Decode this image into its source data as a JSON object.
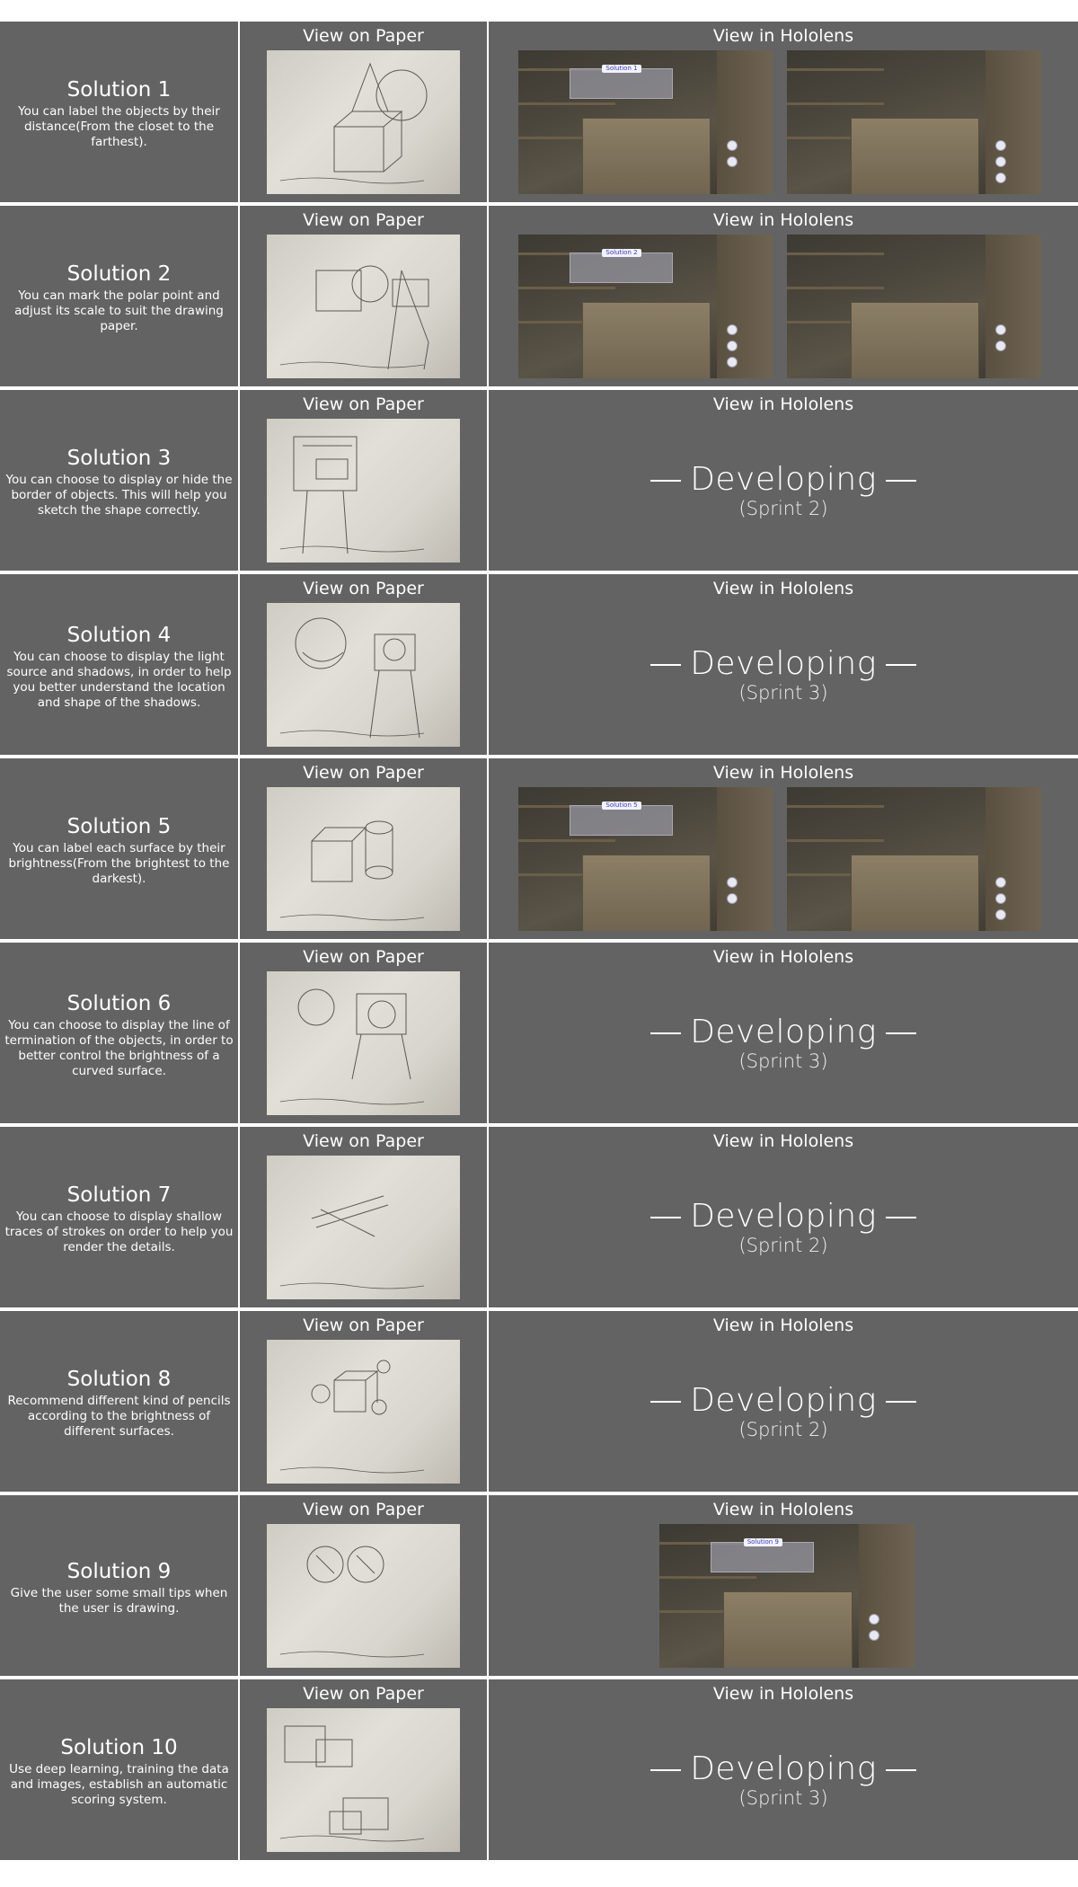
{
  "headers": {
    "paper": "View on Paper",
    "holo": "View in Hololens"
  },
  "developing": {
    "label": "Developing"
  },
  "solutions": [
    {
      "title": "Solution 1",
      "text": "You can label the objects by their distance(From the closet to the farthest).",
      "holo_images": 2,
      "sprint": null,
      "tag": "Solution 1"
    },
    {
      "title": "Solution 2",
      "text": "You can mark the polar point and adjust its scale to suit the drawing paper.",
      "holo_images": 2,
      "sprint": null,
      "tag": "Solution 2"
    },
    {
      "title": "Solution 3",
      "text": "You can choose to display or hide the border of objects. This will help you sketch the shape correctly.",
      "holo_images": 0,
      "sprint": "(Sprint 2)"
    },
    {
      "title": "Solution 4",
      "text": "You can choose to display the light source and shadows, in order to help you better understand the location and shape of the shadows.",
      "holo_images": 0,
      "sprint": "(Sprint 3)"
    },
    {
      "title": "Solution 5",
      "text": "You can label each surface by their brightness(From the brightest to the darkest).",
      "holo_images": 2,
      "sprint": null,
      "tag": "Solution 5"
    },
    {
      "title": "Solution 6",
      "text": "You can choose to display the line of termination of the objects, in order to better control the brightness of a curved surface.",
      "holo_images": 0,
      "sprint": "(Sprint 3)"
    },
    {
      "title": "Solution 7",
      "text": "You can choose to display shallow traces of strokes on order to help you render the details.",
      "holo_images": 0,
      "sprint": "(Sprint 2)"
    },
    {
      "title": "Solution 8",
      "text": "Recommend different kind of pencils according to the brightness of different surfaces.",
      "holo_images": 0,
      "sprint": "(Sprint 2)"
    },
    {
      "title": "Solution 9",
      "text": "Give the user some small tips when the user is drawing.",
      "holo_images": 1,
      "sprint": null,
      "tag": "Solution 9"
    },
    {
      "title": "Solution 10",
      "text": "Use deep learning, training the data and images, establish an automatic scoring system.",
      "holo_images": 0,
      "sprint": "(Sprint 3)"
    }
  ]
}
